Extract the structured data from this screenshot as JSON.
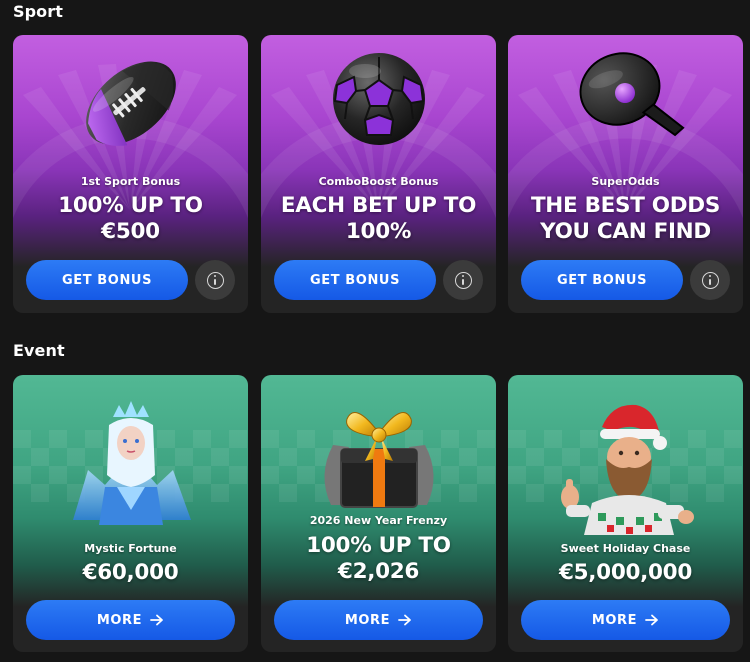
{
  "sections": {
    "sport": {
      "title": "Sport"
    },
    "event": {
      "title": "Event"
    }
  },
  "sport_cards": [
    {
      "subtitle": "1st Sport Bonus",
      "headline_line1": "100% UP TO",
      "headline_line2": "€500",
      "button": "GET BONUS",
      "art": "american-football-icon"
    },
    {
      "subtitle": "ComboBoost Bonus",
      "headline_line1": "EACH BET UP TO",
      "headline_line2": "100%",
      "button": "GET BONUS",
      "art": "soccer-ball-icon"
    },
    {
      "subtitle": "SuperOdds",
      "headline_line1": "THE BEST ODDS",
      "headline_line2": "YOU CAN FIND",
      "button": "GET BONUS",
      "art": "ping-pong-paddle-icon"
    }
  ],
  "event_cards": [
    {
      "subtitle": "Mystic Fortune",
      "headline_line1": "€60,000",
      "button": "MORE",
      "art": "ice-queen-character"
    },
    {
      "subtitle": "2026 New Year Frenzy",
      "headline_line1": "100% UP TO",
      "headline_line2": "€2,026",
      "button": "MORE",
      "art": "gift-box-icon"
    },
    {
      "subtitle": "Sweet Holiday Chase",
      "headline_line1": "€5,000,000",
      "button": "MORE",
      "art": "santa-character"
    }
  ],
  "colors": {
    "page_bg": "#161616",
    "card_bg": "#242424",
    "sport_accent": "#b453d8",
    "event_accent": "#46ab88",
    "button_blue": "#1f66ee",
    "info_button": "#3b3b3b"
  }
}
